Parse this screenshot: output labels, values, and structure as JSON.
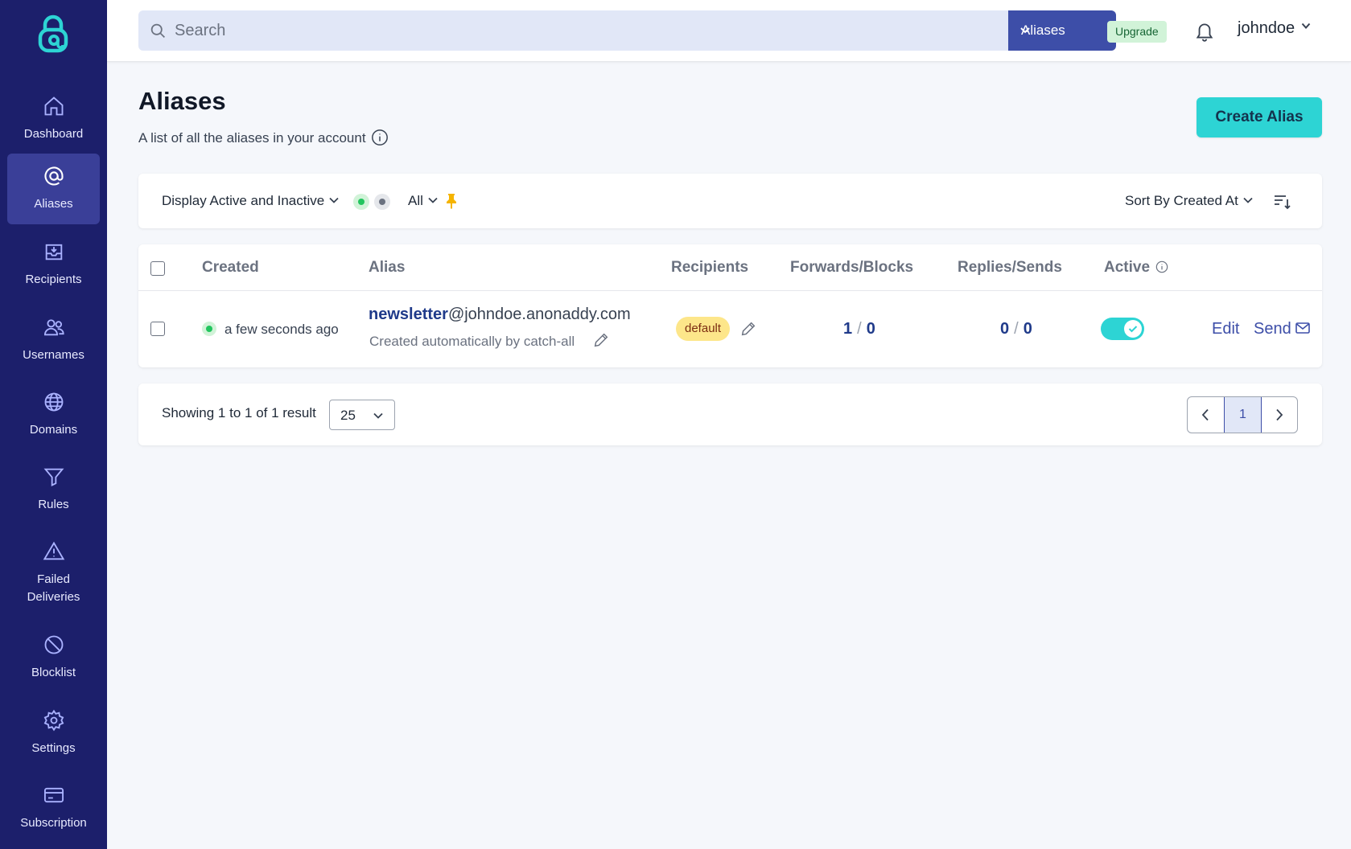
{
  "sidebar": {
    "items": [
      {
        "label": "Dashboard",
        "icon": "home-icon"
      },
      {
        "label": "Aliases",
        "icon": "at-icon",
        "active": true
      },
      {
        "label": "Recipients",
        "icon": "inbox-icon"
      },
      {
        "label": "Usernames",
        "icon": "users-icon"
      },
      {
        "label": "Domains",
        "icon": "globe-icon"
      },
      {
        "label": "Rules",
        "icon": "filter-icon"
      },
      {
        "label": "Failed Deliveries",
        "icon": "warning-icon"
      },
      {
        "label": "Blocklist",
        "icon": "ban-icon"
      },
      {
        "label": "Settings",
        "icon": "gear-icon"
      },
      {
        "label": "Subscription",
        "icon": "credit-card-icon"
      }
    ]
  },
  "topbar": {
    "search_placeholder": "Search",
    "scope": "Aliases",
    "upgrade": "Upgrade",
    "username": "johndoe"
  },
  "header": {
    "title": "Aliases",
    "subtitle": "A list of all the aliases in your account",
    "create_button": "Create Alias"
  },
  "filters": {
    "display": "Display Active and Inactive",
    "type": "All",
    "sort": "Sort By Created At"
  },
  "table": {
    "columns": {
      "created": "Created",
      "alias": "Alias",
      "recipients": "Recipients",
      "forwards_blocks": "Forwards/Blocks",
      "replies_sends": "Replies/Sends",
      "active": "Active"
    },
    "rows": [
      {
        "created": "a few seconds ago",
        "alias_local": "newsletter",
        "alias_domain": "@johndoe.anonaddy.com",
        "description": "Created automatically by catch-all",
        "recipient_badge": "default",
        "forwards": "1",
        "blocks": "0",
        "replies": "0",
        "sends": "0",
        "count_separator": "/",
        "active": true,
        "edit_label": "Edit",
        "send_label": "Send"
      }
    ]
  },
  "pagination": {
    "summary": "Showing 1 to 1 of 1 result",
    "per_page": "25",
    "current_page": "1"
  },
  "colors": {
    "sidebar_bg": "#1c1f6b",
    "sidebar_active": "#3a3f98",
    "accent": "#2dd4d4",
    "primary": "#3d4ea8"
  }
}
